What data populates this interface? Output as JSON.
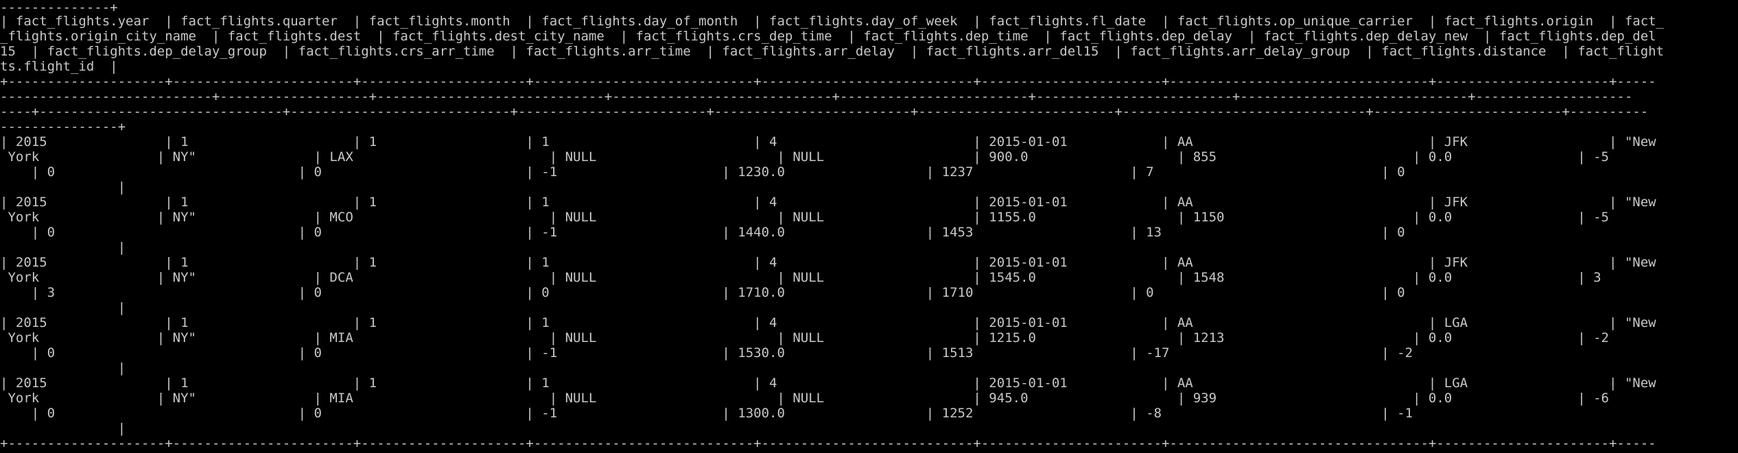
{
  "terminal": {
    "foreground": "#c8c8c8",
    "background": "#000000",
    "lines": [
      "--------------+",
      "| fact_flights.year  | fact_flights.quarter  | fact_flights.month  | fact_flights.day_of_month  | fact_flights.day_of_week  | fact_flights.fl_date  | fact_flights.op_unique_carrier  | fact_flights.origin  | fact_",
      "_flights.origin_city_name  | fact_flights.dest  | fact_flights.dest_city_name  | fact_flights.crs_dep_time  | fact_flights.dep_time  | fact_flights.dep_delay  | fact_flights.dep_delay_new  | fact_flights.dep_del",
      "15  | fact_flights.dep_delay_group  | fact_flights.crs_arr_time  | fact_flights.arr_time  | fact_flights.arr_delay  | fact_flights.arr_del15  | fact_flights.arr_delay_group  | fact_flights.distance  | fact_flight",
      "ts.flight_id  |",
      "+--------------------+-----------------------+---------------------+----------------------------+---------------------------+-----------------------+---------------------------------+----------------------+-----",
      "---------------------------+-------------------+-----------------------------+----------------------------+------------------------+-------------------------+-----------------------------+--------------------",
      "----+-------------------------------+----------------------------+------------------------+-------------------------+-------------------------+-------------------------------+------------------------+----------",
      "---------------+",
      "| 2015               | 1                     | 1                   | 1                          | 4                         | 2015-01-01            | AA                              | JFK                  | \"New",
      " York               | NY\"               | LAX                         | NULL                       | NULL                   | 900.0                   | 855                         | 0.0                | -5",
      "    | 0                               | 0                          | -1                     | 1230.0                  | 1237                    | 7                             | 0",
      "               |",
      "| 2015               | 1                     | 1                   | 1                          | 4                         | 2015-01-01            | AA                              | JFK                  | \"New",
      " York               | NY\"               | MCO                         | NULL                       | NULL                   | 1155.0                  | 1150                        | 0.0                | -5",
      "    | 0                               | 0                          | -1                     | 1440.0                  | 1453                    | 13                            | 0",
      "               |",
      "| 2015               | 1                     | 1                   | 1                          | 4                         | 2015-01-01            | AA                              | JFK                  | \"New",
      " York               | NY\"               | DCA                         | NULL                       | NULL                   | 1545.0                  | 1548                        | 0.0                | 3",
      "    | 3                               | 0                          | 0                      | 1710.0                  | 1710                    | 0                             | 0",
      "               |",
      "| 2015               | 1                     | 1                   | 1                          | 4                         | 2015-01-01            | AA                              | LGA                  | \"New",
      " York               | NY\"               | MIA                         | NULL                       | NULL                   | 1215.0                  | 1213                        | 0.0                | -2",
      "    | 0                               | 0                          | -1                     | 1530.0                  | 1513                    | -17                           | -2",
      "               |",
      "| 2015               | 1                     | 1                   | 1                          | 4                         | 2015-01-01            | AA                              | LGA                  | \"New",
      " York               | NY\"               | MIA                         | NULL                       | NULL                   | 945.0                   | 939                         | 0.0                | -6",
      "    | 0                               | 0                          | -1                     | 1300.0                  | 1252                    | -8                            | -1",
      "               |",
      "+--------------------+-----------------------+---------------------+----------------------------+---------------------------+-----------------------+---------------------------------+----------------------+-----"
    ]
  }
}
